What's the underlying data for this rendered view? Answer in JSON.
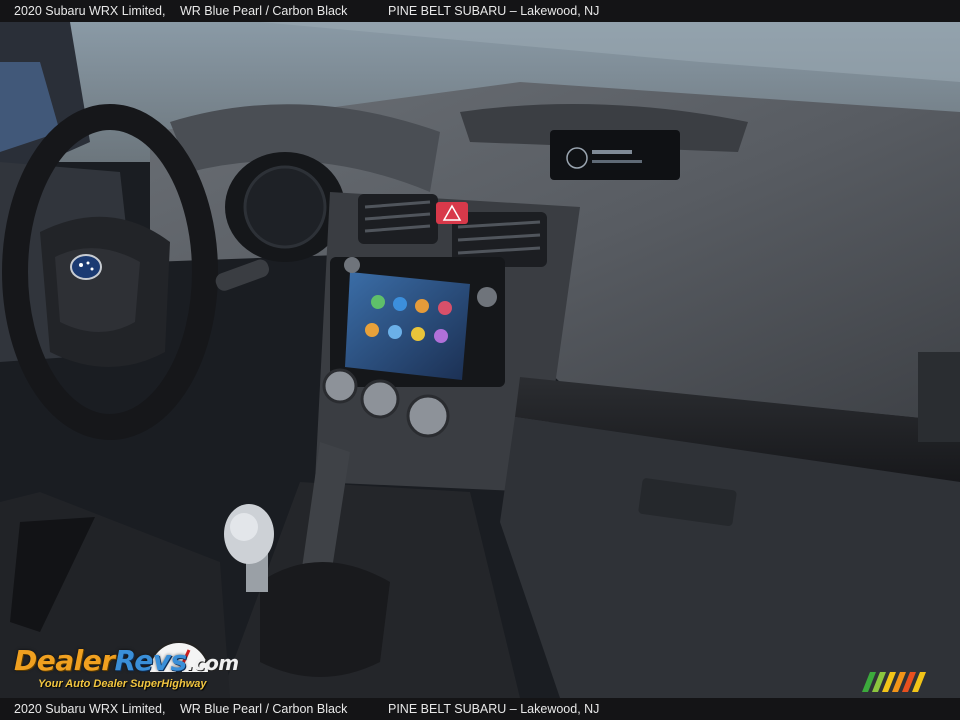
{
  "caption": {
    "model": "2020 Subaru WRX Limited,",
    "trim": "WR Blue Pearl / Carbon Black",
    "dealer": "PINE BELT SUBARU – Lakewood, NJ"
  },
  "watermark": {
    "brand_part1": "Dealer",
    "brand_part2": "Revs",
    "brand_part3": ".com",
    "tagline": "Your Auto Dealer SuperHighway"
  },
  "colors": {
    "caption_bg": "#141416",
    "caption_text": "#e8e8e8",
    "logo_orange": "#f0a020",
    "logo_blue": "#3a8fd8",
    "dash_gray": "#5b6066",
    "hazard_red": "#d8394a"
  },
  "icons": [
    "subaru-logo-icon",
    "hazard-button-icon",
    "gear-shift-knob-icon",
    "speedometer-gauge-icon",
    "color-stripes-icon"
  ]
}
